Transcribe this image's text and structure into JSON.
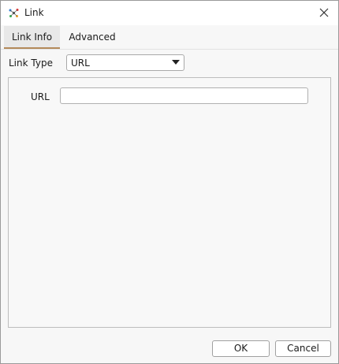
{
  "window": {
    "title": "Link",
    "icon": "link-app-icon",
    "close_icon": "close-icon"
  },
  "tabs": [
    {
      "label": "Link Info",
      "active": true
    },
    {
      "label": "Advanced",
      "active": false
    }
  ],
  "link_type": {
    "label": "Link Type",
    "selected": "URL"
  },
  "url_field": {
    "label": "URL",
    "value": ""
  },
  "buttons": {
    "ok": "OK",
    "cancel": "Cancel"
  },
  "colors": {
    "active_tab_underline": "#b38a5a",
    "active_tab_bg": "#e8e8e8"
  }
}
